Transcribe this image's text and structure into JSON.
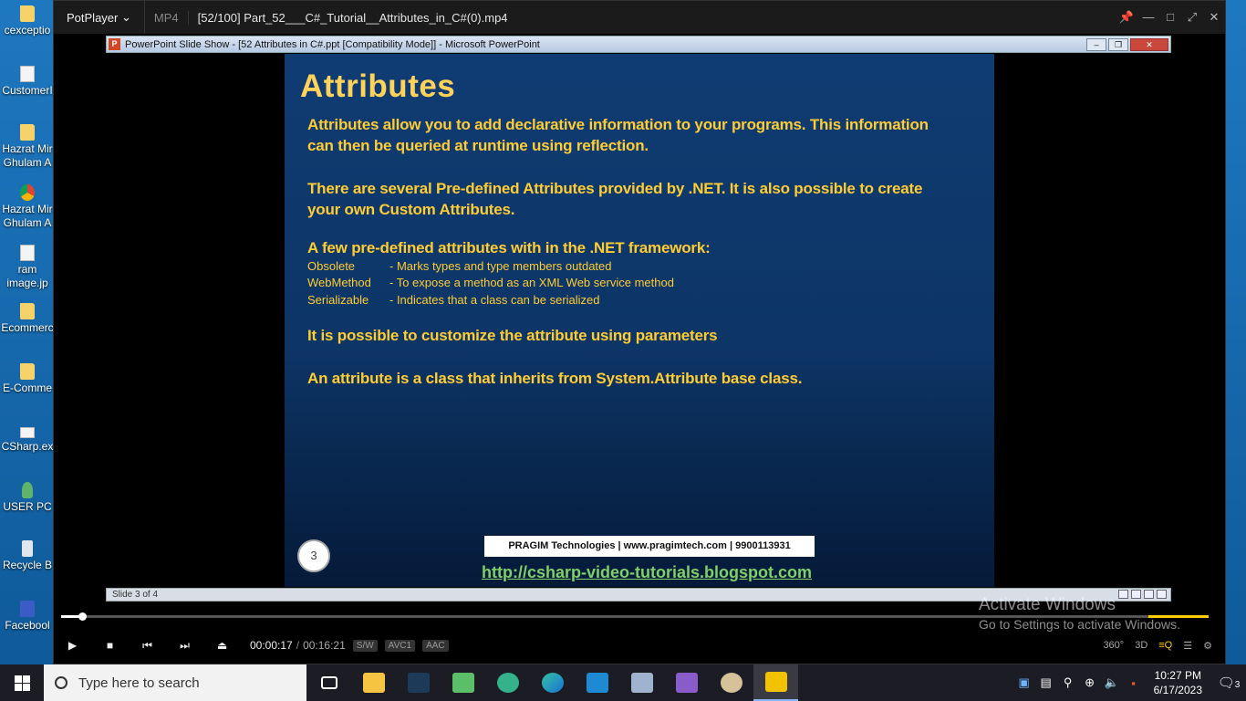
{
  "desktop": {
    "icons": [
      {
        "label": "cexceptio",
        "kind": "folder"
      },
      {
        "label": "CustomerI",
        "kind": "file"
      },
      {
        "label": "Hazrat Mir\nGhulam A",
        "kind": "folder"
      },
      {
        "label": "Hazrat Mir\nGhulam A",
        "kind": "chrome"
      },
      {
        "label": "ram\nimage.jp",
        "kind": "file"
      },
      {
        "label": "Ecommerc",
        "kind": "folder"
      },
      {
        "label": "E-Comme",
        "kind": "folder"
      },
      {
        "label": "CSharp.ex",
        "kind": "file"
      },
      {
        "label": "USER PC",
        "kind": "user"
      },
      {
        "label": "Recycle B",
        "kind": "recycle"
      },
      {
        "label": "Facebool",
        "kind": "facebook"
      }
    ]
  },
  "player": {
    "brand": "PotPlayer",
    "format": "MP4",
    "filename": "[52/100] Part_52___C#_Tutorial__Attributes_in_C#(0).mp4",
    "window_buttons": [
      "📌",
      "—",
      "□",
      "⤢",
      "✕"
    ]
  },
  "ppt": {
    "window_title": "PowerPoint Slide Show - [52 Attributes in C#.ppt [Compatibility Mode]] - Microsoft PowerPoint",
    "status": "Slide 3 of 4"
  },
  "slide": {
    "title": "Attributes",
    "p1": "Attributes allow you to add declarative information to your programs. This information",
    "p1b": "can then be queried at runtime using reflection.",
    "p2": "There are several Pre-defined Attributes provided by .NET. It is also possible to create",
    "p2b": "your own Custom Attributes.",
    "p3": "A few pre-defined attributes with in the .NET framework:",
    "attrs": [
      {
        "name": "Obsolete",
        "desc": "- Marks types and type members outdated"
      },
      {
        "name": "WebMethod",
        "desc": "- To expose a method as an XML Web service  method"
      },
      {
        "name": "Serializable",
        "desc": "- Indicates that a class can be serialized"
      }
    ],
    "p4": "It is possible to customize the attribute using parameters",
    "p5": "An attribute is a class that inherits from System.Attribute base class.",
    "number": "3",
    "footer": "PRAGIM Technologies | www.pragimtech.com | 9900113931",
    "url": "http://csharp-video-tutorials.blogspot.com"
  },
  "controls": {
    "time": "00:00:17",
    "duration": "00:16:21",
    "tags": [
      "S/W",
      "AVC1",
      "AAC"
    ],
    "right": [
      "360°",
      "3D",
      "≡Q",
      "☰",
      "⚙"
    ],
    "progress": 0.018
  },
  "watermark": {
    "title": "Activate Windows",
    "sub": "Go to Settings to activate Windows."
  },
  "taskbar": {
    "search_placeholder": "Type here to search",
    "clock_time": "10:27 PM",
    "clock_date": "6/17/2023",
    "notif_count": "3"
  }
}
